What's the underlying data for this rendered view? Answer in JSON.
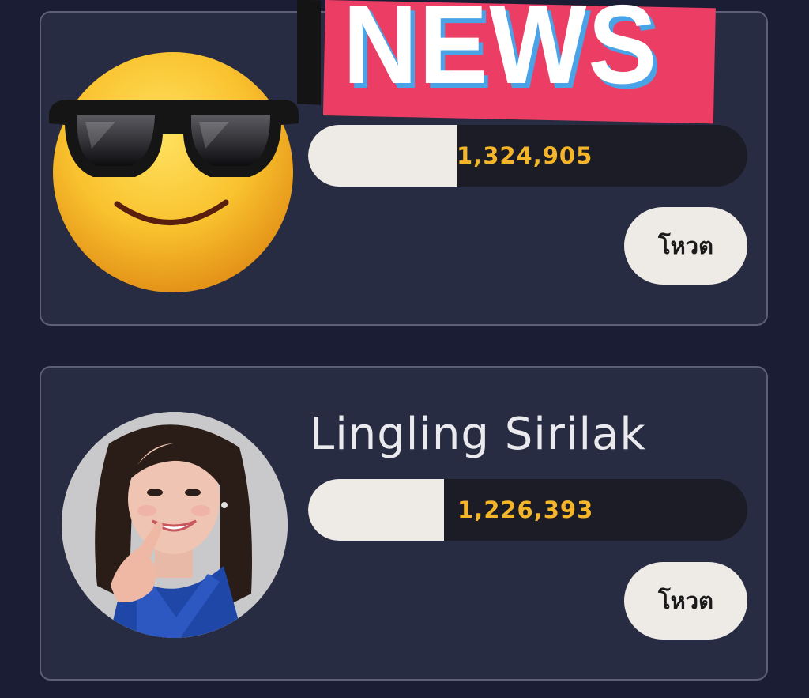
{
  "sticker": {
    "news_text": "NEWS",
    "emoji_name": "smiling-face-with-sunglasses-icon"
  },
  "contestants": [
    {
      "name": "",
      "votes": "1,324,905",
      "vote_bar_fraction": 0.34,
      "vote_button_label": "โหวต"
    },
    {
      "name": "Lingling Sirilak",
      "votes": "1,226,393",
      "vote_bar_fraction": 0.31,
      "vote_button_label": "โหวต"
    }
  ],
  "colors": {
    "background": "#1b1d35",
    "card": "#282c42",
    "vote_count": "#f4b52a",
    "bar_fill": "#eeeae6",
    "news_pink": "#ec3e64",
    "news_shadow": "#4aa3e6"
  }
}
